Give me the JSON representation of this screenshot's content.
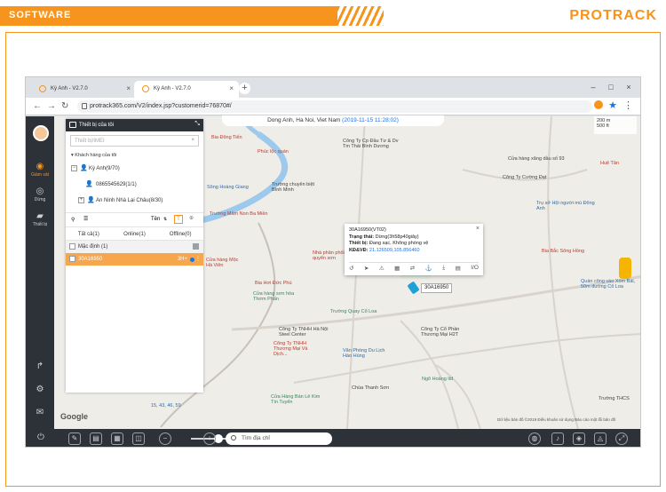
{
  "header": {
    "section": "SOFTWARE",
    "brand": "PROTRACK"
  },
  "browser": {
    "tabs": [
      {
        "title": "Kỳ Anh - V2.7.0"
      },
      {
        "title": "Kỳ Anh - V2.7.0"
      }
    ],
    "url": "protrack365.com/V2/index.jsp?customerid=76870#/"
  },
  "sidebar": {
    "items": [
      {
        "label": "Giám sát",
        "icon": "binoculars-icon"
      },
      {
        "label": "Dừng",
        "icon": "stop-icon"
      },
      {
        "label": "Thiết bị",
        "icon": "car-icon"
      }
    ],
    "bottom_icons": [
      "share-icon",
      "settings-icon",
      "mail-icon"
    ]
  },
  "device_panel": {
    "title": "Thiết bị của tôi",
    "search_placeholder": "Thiết bị/IMEI",
    "group_header": "Khách hàng của tôi",
    "tree": [
      {
        "label": "Kỳ Anh(9/70)"
      },
      {
        "label": "0865545629(1/1)"
      },
      {
        "label": "An Ninh Nhà Lại Châu(8/30)"
      }
    ],
    "sort_label": "Tên",
    "status_tabs": [
      {
        "label": "Tất cả(1)"
      },
      {
        "label": "Online(1)"
      },
      {
        "label": "Offline(0)"
      }
    ],
    "list_group": "Mặc định (1)",
    "list_item": {
      "name": "30A16950",
      "status": "3H+"
    }
  },
  "map": {
    "address_bar": "Dong Anh, Ha Noi, Viet Nam",
    "address_time": "(2019-11-15 11:28:02)",
    "scale": [
      "200 m",
      "500 ft"
    ],
    "places": [
      {
        "name": "Bia Đông Tiến",
        "color": "red"
      },
      {
        "name": "Phúc lộc quán",
        "color": "red"
      },
      {
        "name": "Công Ty Cp Đầu Tư & Dv Tm Thái Bình Dương",
        "color": "dark"
      },
      {
        "name": "Cửa hàng xăng dầu số 93",
        "color": "dark"
      },
      {
        "name": "Công Ty Cường Đạt",
        "color": "dark"
      },
      {
        "name": "Huệ Tân",
        "color": "red"
      },
      {
        "name": "Trường chuyên biệt Bình Minh",
        "color": "dark"
      },
      {
        "name": "Sông Hoàng Giang",
        "color": "blue"
      },
      {
        "name": "Trường Mầm Non Ba Miền",
        "color": "red"
      },
      {
        "name": "Trụ sở Hội người mù Đông Anh",
        "color": "blue"
      },
      {
        "name": "Bia Bắc Sông Hồng",
        "color": "red"
      },
      {
        "name": "Cửa hàng Mộc Hà Viên",
        "color": "red"
      },
      {
        "name": "Nhà phân phối quyển sơn",
        "color": "red"
      },
      {
        "name": "Bia Hơi Đức Phú",
        "color": "red"
      },
      {
        "name": "Cửa hàng sơn hóa Thơm Phấn",
        "color": "green"
      },
      {
        "name": "Quán công vào Xóm Bái, 50m đường Cổ Loa",
        "color": "blue"
      },
      {
        "name": "Trường Quay Cổ Loa",
        "color": "green"
      },
      {
        "name": "Công Ty TNHH Hà Nội Steel Center",
        "color": "dark"
      },
      {
        "name": "Công Ty Cổ Phần Thương Mại H2T",
        "color": "dark"
      },
      {
        "name": "Công Ty TNHH Thương Mại Và Dịch...",
        "color": "red"
      },
      {
        "name": "Văn Phòng Du Lịch Hào Hùng",
        "color": "blue"
      },
      {
        "name": "Ngõ Hoàng ltd",
        "color": "green"
      },
      {
        "name": "Chùa Thanh Sơn",
        "color": "dark"
      },
      {
        "name": "Cửa Hàng Bán Lẻ Kim Tín Tuyển",
        "color": "green"
      },
      {
        "name": "15, 43, 46, 59",
        "color": "blue"
      },
      {
        "name": "Trường THCS",
        "color": "dark"
      }
    ],
    "copyright": "Dữ liệu bản đồ ©2019  Điều khoản sử dụng  Báo cáo một lỗi bản đồ"
  },
  "popup": {
    "title": "30A16950(VT02)",
    "status_label": "Trạng thái:",
    "status_value": "Dừng(3h58p40giây)",
    "device_label": "Thiết bị:",
    "device_value": "Đang sạc, Không phòng vệ",
    "coord_label": "KĐ&VĐ:",
    "coord_value": "21.126509,105.856460"
  },
  "vehicle_label": "30A16950",
  "bottom_search": "Tìm địa chỉ",
  "colors": {
    "accent": "#f7941d",
    "dark_ui": "#2d3138"
  }
}
